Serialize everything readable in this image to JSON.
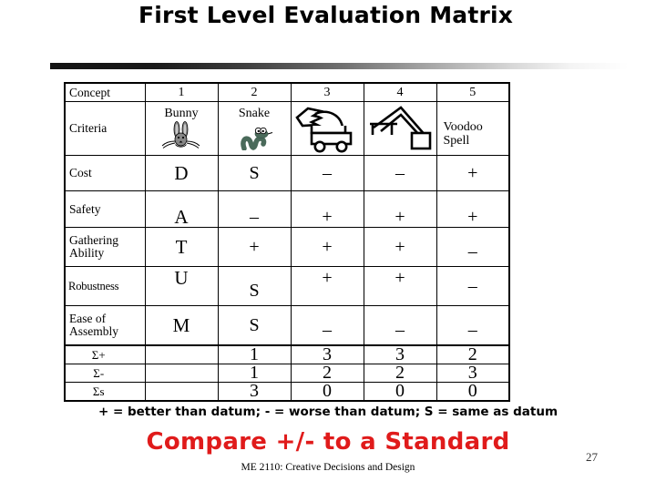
{
  "slide": {
    "title": "First Level Evaluation Matrix",
    "page_number": "27",
    "credit": "ME 2110: Creative Decisions and Design",
    "legend_note": "+ = better than datum; - = worse than datum; S = same as datum",
    "callout": "Compare +/- to a Standard",
    "callout_color": "#E01B1B"
  },
  "matrix": {
    "header_label": "Concept",
    "criteria_label": "Criteria",
    "columns": [
      {
        "number": "1",
        "name": "Bunny",
        "icon": "bunny-icon"
      },
      {
        "number": "2",
        "name": "Snake",
        "icon": "snake-icon"
      },
      {
        "number": "3",
        "name": "",
        "icon": "backhoe-icon"
      },
      {
        "number": "4",
        "name": "",
        "icon": "crane-icon"
      },
      {
        "number": "5",
        "name": "Voodoo Spell",
        "icon": "none"
      }
    ],
    "rows": [
      {
        "criterion": "Cost",
        "values": [
          "D",
          "S",
          "–",
          "–",
          "+"
        ]
      },
      {
        "criterion": "Safety",
        "values": [
          "A",
          "–",
          "+",
          "+",
          "+"
        ]
      },
      {
        "criterion": "Gathering Ability",
        "values": [
          "T",
          "+",
          "+",
          "+",
          "–"
        ]
      },
      {
        "criterion": "Robustness",
        "values": [
          "U",
          "S",
          "+",
          "+",
          "–"
        ]
      },
      {
        "criterion": "Ease of Assembly",
        "values": [
          "M",
          "S",
          "–",
          "–",
          "–"
        ]
      }
    ],
    "summary": [
      {
        "label": "Σ+",
        "values": [
          "",
          "1",
          "3",
          "3",
          "2"
        ]
      },
      {
        "label": "Σ-",
        "values": [
          "",
          "1",
          "2",
          "2",
          "3"
        ]
      },
      {
        "label": "Σs",
        "values": [
          "",
          "3",
          "0",
          "0",
          "0"
        ]
      }
    ]
  },
  "colors": {
    "bunny_gray": "#878787",
    "snake_green": "#4A6A5A",
    "icon_black": "#000000"
  }
}
